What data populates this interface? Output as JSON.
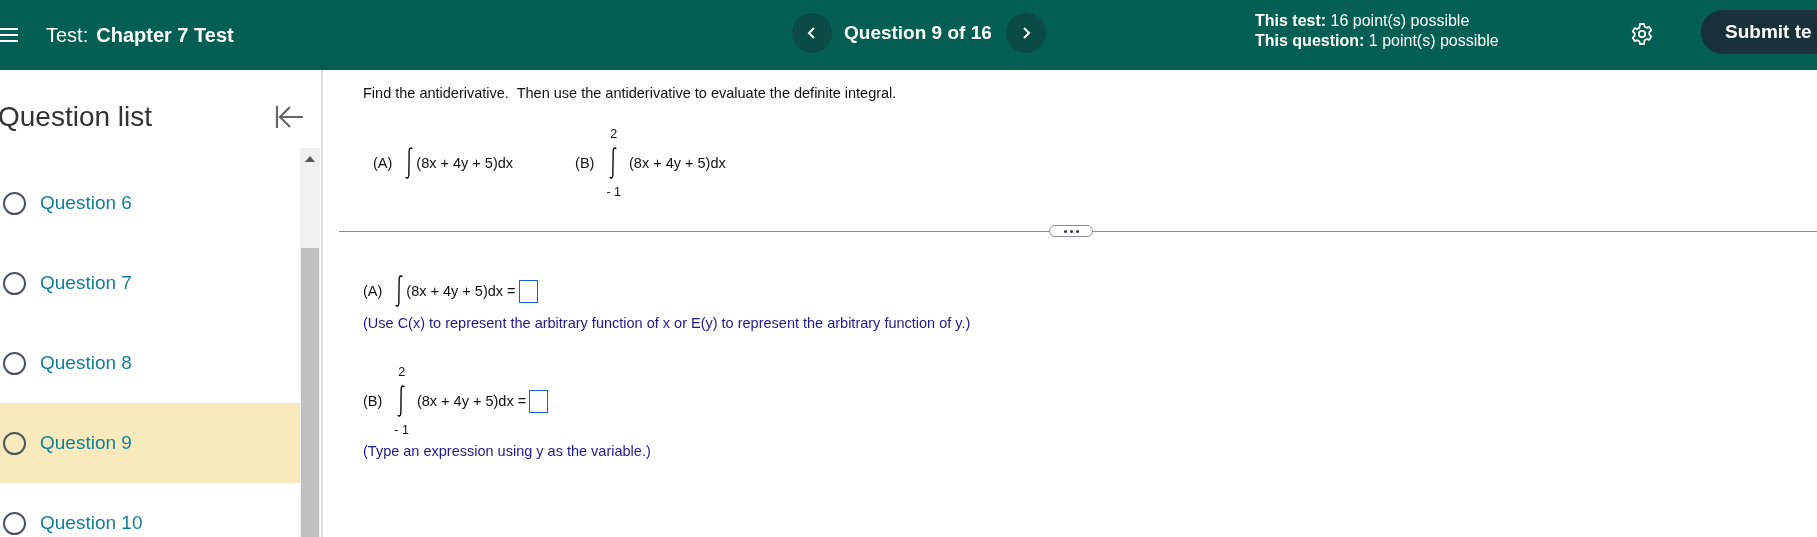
{
  "header": {
    "test_label": "Test:",
    "test_name": "Chapter 7 Test",
    "question_position": "Question 9 of 16",
    "points": [
      {
        "label": "This test:",
        "value": "16 point(s) possible"
      },
      {
        "label": "This question:",
        "value": "1 point(s) possible"
      }
    ],
    "submit": "Submit te"
  },
  "sidebar": {
    "title": "Question list",
    "items": [
      {
        "label": "Question 6",
        "selected": false
      },
      {
        "label": "Question 7",
        "selected": false
      },
      {
        "label": "Question 8",
        "selected": false
      },
      {
        "label": "Question 9",
        "selected": true
      },
      {
        "label": "Question 10",
        "selected": false
      }
    ]
  },
  "question": {
    "instruction": "Find the antiderivative.  Then use the antiderivative to evaluate the definite integral.",
    "parts": [
      {
        "kind": "indefinite",
        "label": "(A)",
        "integrand": "(8x + 4y + 5)dx"
      },
      {
        "kind": "definite",
        "label": "(B)",
        "upper": "2",
        "lower": "- 1",
        "integrand": "(8x + 4y + 5)dx"
      }
    ],
    "answers": [
      {
        "kind": "indefinite",
        "label": "(A)",
        "integrand": "(8x + 4y + 5)dx =",
        "hint": "(Use C(x) to represent the arbitrary function of x or E(y) to represent the arbitrary function of y.)"
      },
      {
        "kind": "definite",
        "label": "(B)",
        "upper": "2",
        "lower": "- 1",
        "integrand": "(8x + 4y + 5)dx =",
        "hint": "(Type an expression using y as the variable.)"
      }
    ]
  }
}
